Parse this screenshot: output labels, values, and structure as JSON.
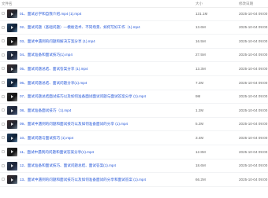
{
  "header": {
    "name_label": "文件名",
    "size_label": "大小",
    "date_label": "修改日期"
  },
  "files": [
    {
      "name": "01、面试必学和自我介绍.mp4 (1).mp4",
      "size": "131.1M",
      "date": "2025-10-04 09:00"
    },
    {
      "name": "02、面试问题（基础问题）—模板话术、不同场景、如何写好工作（1).mp4",
      "size": "13.6M",
      "date": "2025-10-04 09:00"
    },
    {
      "name": "03、面试中遇到的问题和解决方案分享 (1).mp4",
      "size": "16.5M",
      "date": "2025-10-04 09:00"
    },
    {
      "name": "04、面试准备和面试技巧(1).mp4",
      "size": "27.5M",
      "date": "2025-10-04 09:00"
    },
    {
      "name": "05、面试问题总结、面试答案分享 (1).mp4",
      "size": "13.3M",
      "date": "2025-10-04 09:00"
    },
    {
      "name": "06、面试问题总结、面试问题分享(1).mp4",
      "size": "7.2M",
      "date": "2025-10-04 09:00"
    },
    {
      "name": "07、面试问题总结面试技巧以及如何准备面试面试问题与面试答案分享 (1).mp4",
      "size": "9M",
      "date": "2025-10-04 09:00"
    },
    {
      "name": "08、面试准备面试技巧（1).mp4",
      "size": "1.2M",
      "date": "2025-10-04 09:00"
    },
    {
      "name": "09、面试中遇到的问题和面试技巧以及如何准备面试的分享 (1).mp4",
      "size": "5.2M",
      "date": "2025-10-04 09:00"
    },
    {
      "name": "10、面试问题与面试技巧 (1).mp4",
      "size": "3.4M",
      "date": "2025-10-04 09:00"
    },
    {
      "name": "11、面试中遇到的问题和面试答案分享(1).mp4",
      "size": "12.8M",
      "date": "2025-10-04 09:00"
    },
    {
      "name": "12、面试准备和面试技巧、面试问题总结、面试答案(1).mp4",
      "size": "18.6M",
      "date": "2025-10-04 09:00"
    },
    {
      "name": "13、面试中遇到的问题和面试技巧以及如何准备面试的分享和面试答案 (1).mp4",
      "size": "66.2M",
      "date": "2025-10-04 09:00"
    }
  ]
}
